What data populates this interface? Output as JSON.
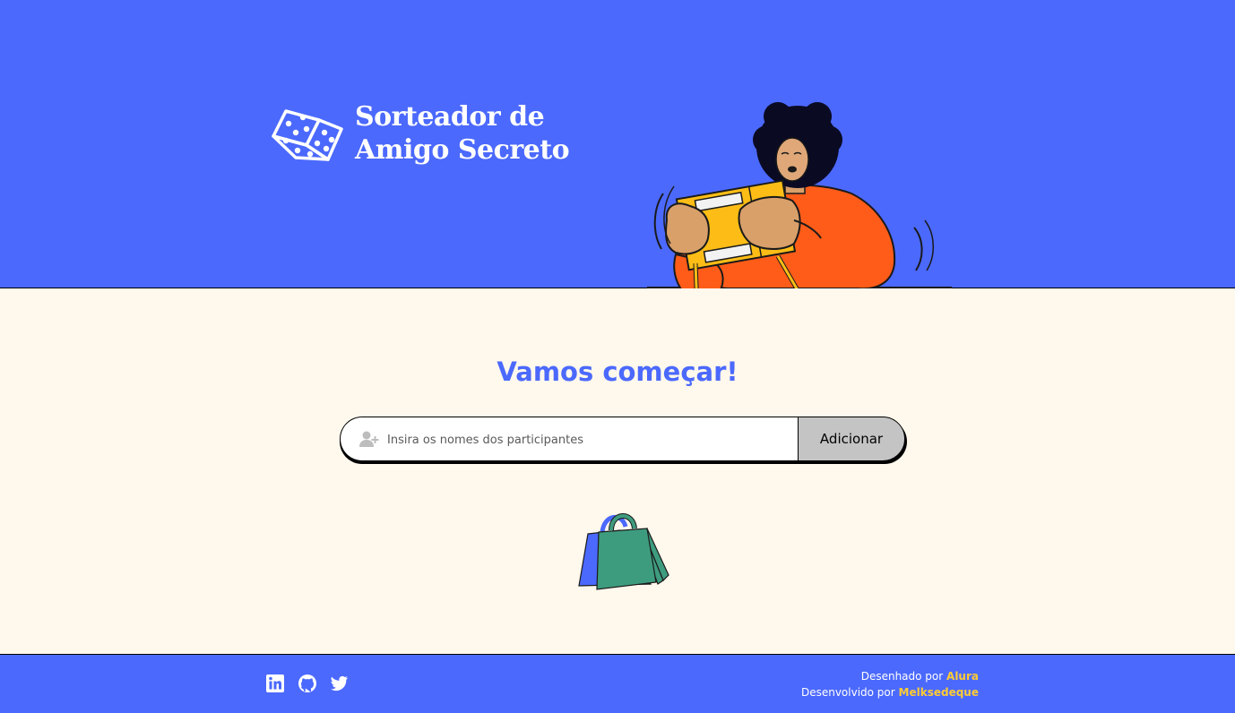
{
  "header": {
    "title_line1": "Sorteador de",
    "title_line2": "Amigo Secreto"
  },
  "main": {
    "heading": "Vamos começar!",
    "input": {
      "placeholder": "Insira os nomes dos participantes",
      "value": ""
    },
    "add_button_label": "Adicionar"
  },
  "footer": {
    "social_icons": [
      "linkedin-icon",
      "github-icon",
      "twitter-icon"
    ],
    "designed_by_prefix": "Desenhado por",
    "designed_by_name": "Alura",
    "developed_by_prefix": "Desenvolvido por",
    "developed_by_name": "Melksedeque"
  },
  "colors": {
    "primary_blue": "#4b69fd",
    "cream_background": "#fff8ec",
    "button_gray": "#c4c4c4",
    "highlight_yellow": "#ffcc33",
    "illustration_orange": "#fe5c18",
    "bag_green": "#3e9c7e"
  }
}
